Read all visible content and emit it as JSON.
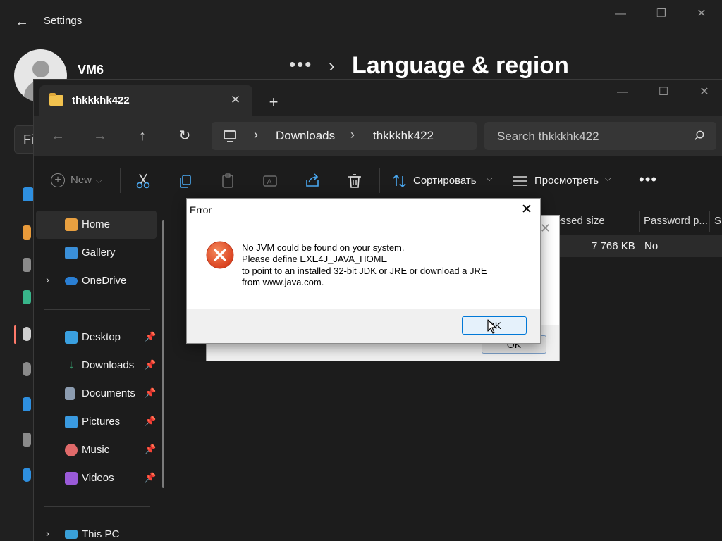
{
  "settings": {
    "title": "Settings",
    "user_name": "VM6",
    "breadcrumb_more": "•••",
    "page_title": "Language & region",
    "find_partial": "Fi"
  },
  "explorer": {
    "tab_title": "thkkkhk422",
    "address": [
      "Downloads",
      "thkkkhk422"
    ],
    "search_placeholder": "Search thkkkhk422",
    "toolbar": {
      "new_label": "New",
      "sort_label": "Сортировать",
      "view_label": "Просмотреть",
      "more_label": "•••"
    },
    "nav": {
      "home": "Home",
      "gallery": "Gallery",
      "onedrive": "OneDrive",
      "desktop": "Desktop",
      "downloads": "Downloads",
      "documents": "Documents",
      "pictures": "Pictures",
      "music": "Music",
      "videos": "Videos",
      "this_pc": "This PC"
    },
    "columns": [
      "mpressed size",
      "Password p...",
      "Si"
    ],
    "row": {
      "compressed_size": "7 766 KB",
      "password_protected": "No"
    }
  },
  "ghost_dialog": {
    "ok_label": "OK"
  },
  "error_dialog": {
    "title": "Error",
    "message_lines": [
      "No JVM could be found on your system.",
      "Please define EXE4J_JAVA_HOME",
      "to point to an installed 32-bit JDK or JRE or download a JRE",
      "from www.java.com."
    ],
    "ok_label": "OK"
  },
  "colors": {
    "dark_bg": "#202020",
    "accent": "#0078d7",
    "error_red": "#e04a2b"
  },
  "icons": {
    "back": "arrow-left-icon",
    "forward": "arrow-right-icon",
    "up": "arrow-up-icon",
    "refresh": "refresh-icon",
    "search": "search-icon",
    "error": "error-x-icon"
  }
}
